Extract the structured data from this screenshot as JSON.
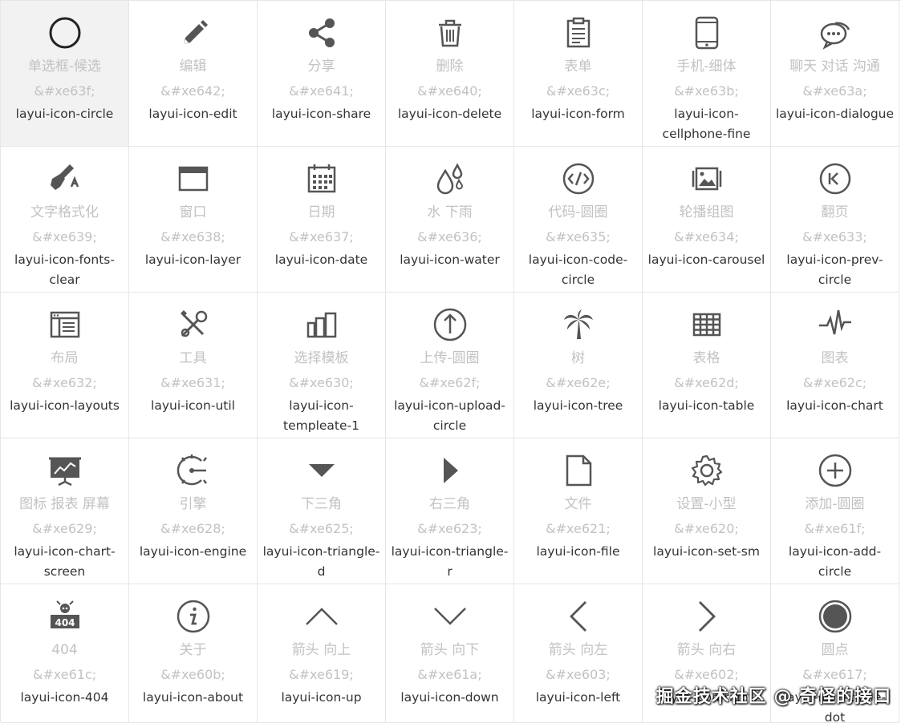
{
  "icons": [
    {
      "name": "单选框-候选",
      "code": "&#xe63f;",
      "cls": "layui-icon-circle",
      "icon": "circle-icon"
    },
    {
      "name": "编辑",
      "code": "&#xe642;",
      "cls": "layui-icon-edit",
      "icon": "edit-icon"
    },
    {
      "name": "分享",
      "code": "&#xe641;",
      "cls": "layui-icon-share",
      "icon": "share-icon"
    },
    {
      "name": "删除",
      "code": "&#xe640;",
      "cls": "layui-icon-delete",
      "icon": "delete-icon"
    },
    {
      "name": "表单",
      "code": "&#xe63c;",
      "cls": "layui-icon-form",
      "icon": "form-icon"
    },
    {
      "name": "手机-细体",
      "code": "&#xe63b;",
      "cls": "layui-icon-cellphone-fine",
      "icon": "cellphone-fine-icon"
    },
    {
      "name": "聊天 对话 沟通",
      "code": "&#xe63a;",
      "cls": "layui-icon-dialogue",
      "icon": "dialogue-icon"
    },
    {
      "name": "文字格式化",
      "code": "&#xe639;",
      "cls": "layui-icon-fonts-clear",
      "icon": "fonts-clear-icon"
    },
    {
      "name": "窗口",
      "code": "&#xe638;",
      "cls": "layui-icon-layer",
      "icon": "layer-icon"
    },
    {
      "name": "日期",
      "code": "&#xe637;",
      "cls": "layui-icon-date",
      "icon": "date-icon"
    },
    {
      "name": "水 下雨",
      "code": "&#xe636;",
      "cls": "layui-icon-water",
      "icon": "water-icon"
    },
    {
      "name": "代码-圆圈",
      "code": "&#xe635;",
      "cls": "layui-icon-code-circle",
      "icon": "code-circle-icon"
    },
    {
      "name": "轮播组图",
      "code": "&#xe634;",
      "cls": "layui-icon-carousel",
      "icon": "carousel-icon"
    },
    {
      "name": "翻页",
      "code": "&#xe633;",
      "cls": "layui-icon-prev-circle",
      "icon": "prev-circle-icon"
    },
    {
      "name": "布局",
      "code": "&#xe632;",
      "cls": "layui-icon-layouts",
      "icon": "layouts-icon"
    },
    {
      "name": "工具",
      "code": "&#xe631;",
      "cls": "layui-icon-util",
      "icon": "util-icon"
    },
    {
      "name": "选择模板",
      "code": "&#xe630;",
      "cls": "layui-icon-templeate-1",
      "icon": "templeate-icon"
    },
    {
      "name": "上传-圆圈",
      "code": "&#xe62f;",
      "cls": "layui-icon-upload-circle",
      "icon": "upload-circle-icon"
    },
    {
      "name": "树",
      "code": "&#xe62e;",
      "cls": "layui-icon-tree",
      "icon": "tree-icon"
    },
    {
      "name": "表格",
      "code": "&#xe62d;",
      "cls": "layui-icon-table",
      "icon": "table-icon"
    },
    {
      "name": "图表",
      "code": "&#xe62c;",
      "cls": "layui-icon-chart",
      "icon": "chart-icon"
    },
    {
      "name": "图标 报表 屏幕",
      "code": "&#xe629;",
      "cls": "layui-icon-chart-screen",
      "icon": "chart-screen-icon"
    },
    {
      "name": "引擎",
      "code": "&#xe628;",
      "cls": "layui-icon-engine",
      "icon": "engine-icon"
    },
    {
      "name": "下三角",
      "code": "&#xe625;",
      "cls": "layui-icon-triangle-d",
      "icon": "triangle-down-icon"
    },
    {
      "name": "右三角",
      "code": "&#xe623;",
      "cls": "layui-icon-triangle-r",
      "icon": "triangle-right-icon"
    },
    {
      "name": "文件",
      "code": "&#xe621;",
      "cls": "layui-icon-file",
      "icon": "file-icon"
    },
    {
      "name": "设置-小型",
      "code": "&#xe620;",
      "cls": "layui-icon-set-sm",
      "icon": "gear-icon"
    },
    {
      "name": "添加-圆圈",
      "code": "&#xe61f;",
      "cls": "layui-icon-add-circle",
      "icon": "add-circle-icon"
    },
    {
      "name": "404",
      "code": "&#xe61c;",
      "cls": "layui-icon-404",
      "icon": "404-icon"
    },
    {
      "name": "关于",
      "code": "&#xe60b;",
      "cls": "layui-icon-about",
      "icon": "about-icon"
    },
    {
      "name": "箭头 向上",
      "code": "&#xe619;",
      "cls": "layui-icon-up",
      "icon": "up-arrow-icon"
    },
    {
      "name": "箭头 向下",
      "code": "&#xe61a;",
      "cls": "layui-icon-down",
      "icon": "down-arrow-icon"
    },
    {
      "name": "箭头 向左",
      "code": "&#xe603;",
      "cls": "layui-icon-left",
      "icon": "left-arrow-icon"
    },
    {
      "name": "箭头 向右",
      "code": "&#xe602;",
      "cls": "layui-icon-right",
      "icon": "right-arrow-icon"
    },
    {
      "name": "圆点",
      "code": "&#xe617;",
      "cls": "layui-icon-circle-dot",
      "icon": "circle-dot-icon"
    }
  ],
  "watermark": "掘金技术社区 @ 奇怪的接口",
  "colors": {
    "icon": "#555555",
    "name": "#c2c2c2",
    "class": "#333333",
    "border": "#e6e6e6",
    "hover": "#f2f2f2"
  }
}
